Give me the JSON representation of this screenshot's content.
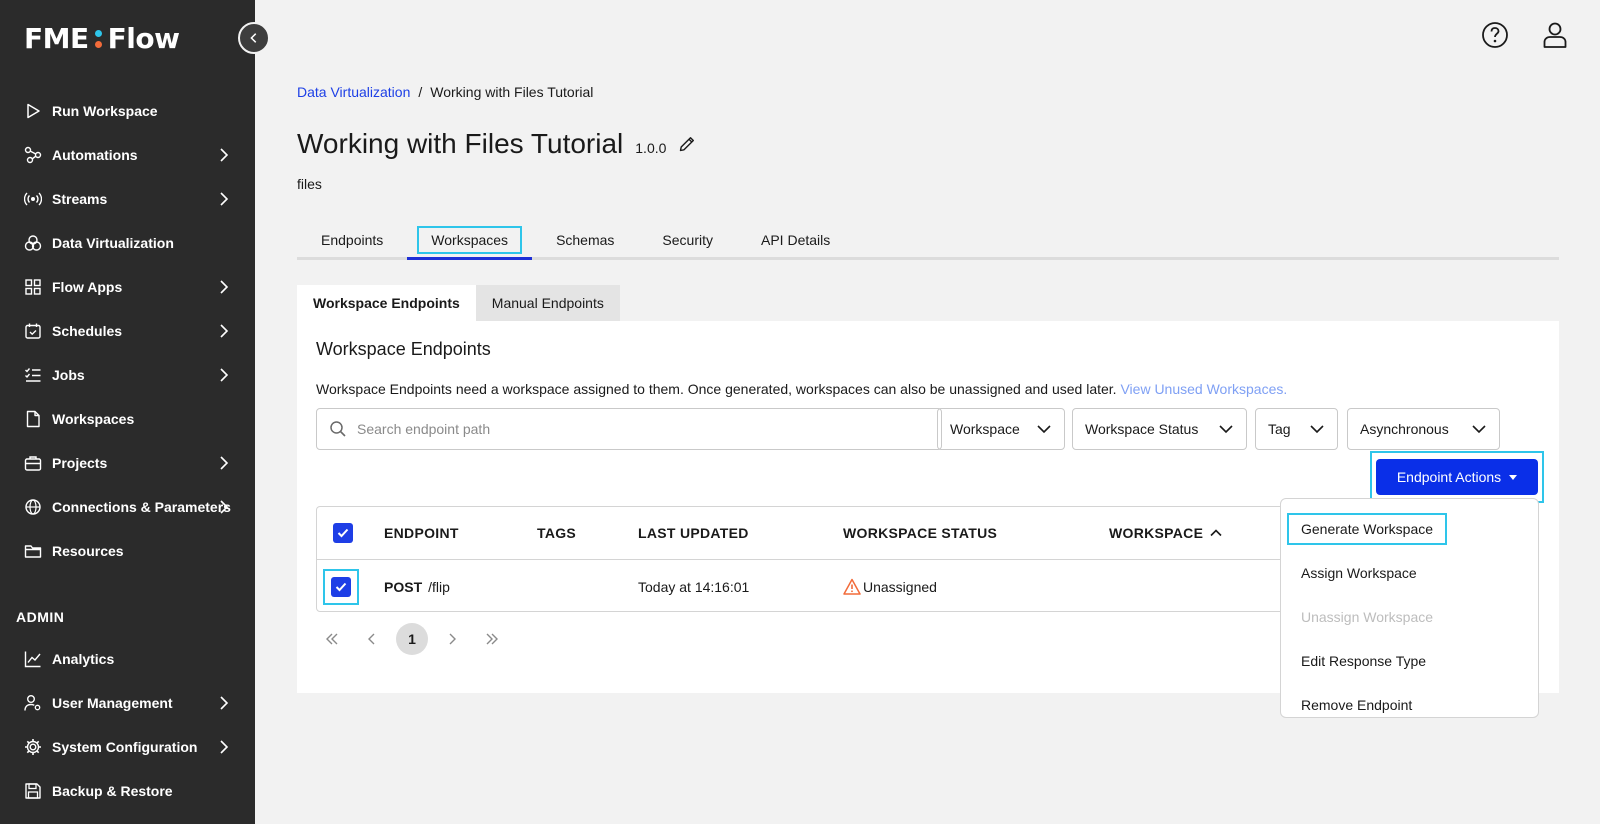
{
  "app": {
    "logo_left": "FME",
    "logo_right": "Flow",
    "logo_dot_colors": [
      "#2ec5ea",
      "#f26b3a"
    ]
  },
  "sidebar": {
    "items": [
      {
        "label": "Run Workspace",
        "icon": "play-icon",
        "chevron": false
      },
      {
        "label": "Automations",
        "icon": "automation-icon",
        "chevron": true
      },
      {
        "label": "Streams",
        "icon": "broadcast-icon",
        "chevron": true
      },
      {
        "label": "Data Virtualization",
        "icon": "data-virtualization-icon",
        "chevron": false
      },
      {
        "label": "Flow Apps",
        "icon": "apps-grid-icon",
        "chevron": true
      },
      {
        "label": "Schedules",
        "icon": "calendar-check-icon",
        "chevron": true
      },
      {
        "label": "Jobs",
        "icon": "checklist-icon",
        "chevron": true
      },
      {
        "label": "Workspaces",
        "icon": "document-icon",
        "chevron": false
      },
      {
        "label": "Projects",
        "icon": "briefcase-icon",
        "chevron": true
      },
      {
        "label": "Connections & Parameters",
        "icon": "globe-gear-icon",
        "chevron": true
      },
      {
        "label": "Resources",
        "icon": "folder-icon",
        "chevron": false
      }
    ],
    "admin_label": "ADMIN",
    "admin_items": [
      {
        "label": "Analytics",
        "icon": "analytics-icon",
        "chevron": false
      },
      {
        "label": "User Management",
        "icon": "user-gear-icon",
        "chevron": true
      },
      {
        "label": "System Configuration",
        "icon": "gear-icon",
        "chevron": true
      },
      {
        "label": "Backup & Restore",
        "icon": "save-icon",
        "chevron": false
      }
    ]
  },
  "breadcrumb": {
    "parent": "Data Virtualization",
    "separator": "/",
    "current": "Working with Files Tutorial"
  },
  "page": {
    "title": "Working with Files Tutorial",
    "version": "1.0.0",
    "subtitle": "files"
  },
  "tabs": [
    "Endpoints",
    "Workspaces",
    "Schemas",
    "Security",
    "API Details"
  ],
  "active_tab": "Workspaces",
  "subtabs": [
    "Workspace Endpoints",
    "Manual Endpoints"
  ],
  "panel": {
    "title": "Workspace Endpoints",
    "description": "Workspace Endpoints need a workspace assigned to them. Once generated, workspaces can also be unassigned and used later.",
    "link": "View Unused Workspaces.",
    "search_placeholder": "Search endpoint path",
    "filters": [
      "Workspace",
      "Workspace Status",
      "Tag",
      "Asynchronous"
    ],
    "actions_button": "Endpoint Actions"
  },
  "table": {
    "columns": [
      "ENDPOINT",
      "TAGS",
      "LAST UPDATED",
      "WORKSPACE STATUS",
      "WORKSPACE"
    ],
    "rows": [
      {
        "method": "POST",
        "path": "/flip",
        "tags": "",
        "last_updated": "Today at 14:16:01",
        "status": "Unassigned",
        "workspace": ""
      }
    ]
  },
  "pagination": {
    "current_page": "1"
  },
  "dropdown": {
    "items": [
      {
        "label": "Generate Workspace",
        "disabled": false
      },
      {
        "label": "Assign Workspace",
        "disabled": false
      },
      {
        "label": "Unassign Workspace",
        "disabled": true
      },
      {
        "label": "Edit Response Type",
        "disabled": false
      },
      {
        "label": "Remove Endpoint",
        "disabled": false
      }
    ]
  },
  "colors": {
    "sidebar_bg": "#2b2b2b",
    "accent": "#0a2fe8",
    "highlight": "#2ec5ea",
    "link": "#1e40e6",
    "warning": "#f26b3a"
  }
}
